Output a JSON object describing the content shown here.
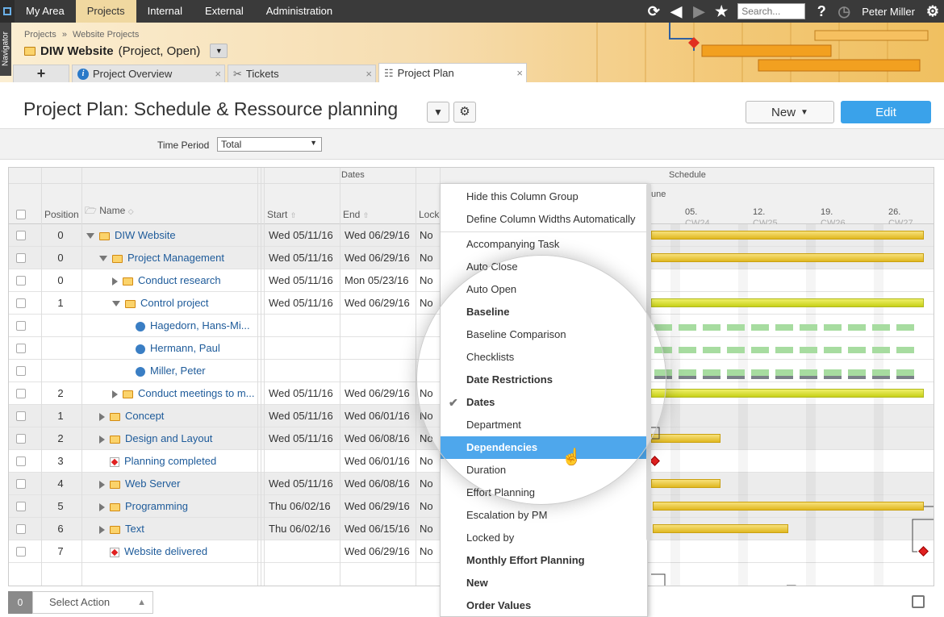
{
  "topnav": {
    "items": [
      "My Area",
      "Projects",
      "Internal",
      "External",
      "Administration"
    ],
    "active_index": 1,
    "search_placeholder": "Search...",
    "user": "Peter Miller",
    "help": "?"
  },
  "navigator_label": "Navigator",
  "breadcrumb": {
    "level1": "Projects",
    "sep": "»",
    "level2": "Website Projects"
  },
  "project": {
    "name": "DIW Website",
    "qualifier": "(Project, Open)"
  },
  "tabs": [
    {
      "label": "+"
    },
    {
      "label": "Project Overview",
      "close": "×"
    },
    {
      "label": "Tickets",
      "close": "×"
    },
    {
      "label": "Project Plan",
      "close": "×"
    }
  ],
  "page_title": "Project Plan: Schedule & Ressource planning",
  "buttons": {
    "new": "New",
    "edit": "Edit"
  },
  "filter": {
    "label": "Time Period",
    "value": "Total"
  },
  "grid": {
    "group_headers": {
      "dates": "Dates",
      "schedule": "Schedule"
    },
    "columns": {
      "position": "Position",
      "name": "Name",
      "start": "Start",
      "end": "End",
      "lock": "Lock"
    },
    "month_label": "une",
    "weeks": [
      {
        "day": "05.",
        "cw": "CW24"
      },
      {
        "day": "12.",
        "cw": "CW25"
      },
      {
        "day": "19.",
        "cw": "CW26"
      },
      {
        "day": "26.",
        "cw": "CW27"
      }
    ],
    "rows": [
      {
        "pos": "0",
        "name": "DIW Website",
        "start": "Wed 05/11/16",
        "end": "Wed 06/29/16",
        "lock": "No"
      },
      {
        "pos": "0",
        "name": "Project Management",
        "start": "Wed 05/11/16",
        "end": "Wed 06/29/16",
        "lock": "No"
      },
      {
        "pos": "0",
        "name": "Conduct research",
        "start": "Wed 05/11/16",
        "end": "Mon 05/23/16",
        "lock": "No"
      },
      {
        "pos": "1",
        "name": "Control project",
        "start": "Wed 05/11/16",
        "end": "Wed 06/29/16",
        "lock": "No"
      },
      {
        "pos": "",
        "name": "Hagedorn, Hans-Mi...",
        "start": "",
        "end": "",
        "lock": ""
      },
      {
        "pos": "",
        "name": "Hermann, Paul",
        "start": "",
        "end": "",
        "lock": ""
      },
      {
        "pos": "",
        "name": "Miller, Peter",
        "start": "",
        "end": "",
        "lock": ""
      },
      {
        "pos": "2",
        "name": "Conduct meetings to m...",
        "start": "Wed 05/11/16",
        "end": "Wed 06/29/16",
        "lock": "No"
      },
      {
        "pos": "1",
        "name": "Concept",
        "start": "Wed 05/11/16",
        "end": "Wed 06/01/16",
        "lock": "No"
      },
      {
        "pos": "2",
        "name": "Design and Layout",
        "start": "Wed 05/11/16",
        "end": "Wed 06/08/16",
        "lock": "No"
      },
      {
        "pos": "3",
        "name": "Planning completed",
        "start": "",
        "end": "Wed 06/01/16",
        "lock": "No"
      },
      {
        "pos": "4",
        "name": "Web Server",
        "start": "Wed 05/11/16",
        "end": "Wed 06/08/16",
        "lock": "No"
      },
      {
        "pos": "5",
        "name": "Programming",
        "start": "Thu 06/02/16",
        "end": "Wed 06/29/16",
        "lock": "No"
      },
      {
        "pos": "6",
        "name": "Text",
        "start": "Thu 06/02/16",
        "end": "Wed 06/15/16",
        "lock": "No"
      },
      {
        "pos": "7",
        "name": "Website delivered",
        "start": "",
        "end": "Wed 06/29/16",
        "lock": "No"
      }
    ]
  },
  "menu": {
    "items": [
      "Hide this Column Group",
      "Define Column Widths Automatically",
      "Accompanying Task",
      "Auto Close",
      "Auto Open",
      "Baseline",
      "Baseline Comparison",
      "Checklists",
      "Date Restrictions",
      "Dates",
      "Department",
      "Dependencies",
      "Duration",
      "Effort Planning",
      "Escalation by PM",
      "Locked by",
      "Monthly Effort Planning",
      "New",
      "Order Values"
    ],
    "check_mark": "✔"
  },
  "selection": {
    "count": "0",
    "action": "Select Action"
  }
}
